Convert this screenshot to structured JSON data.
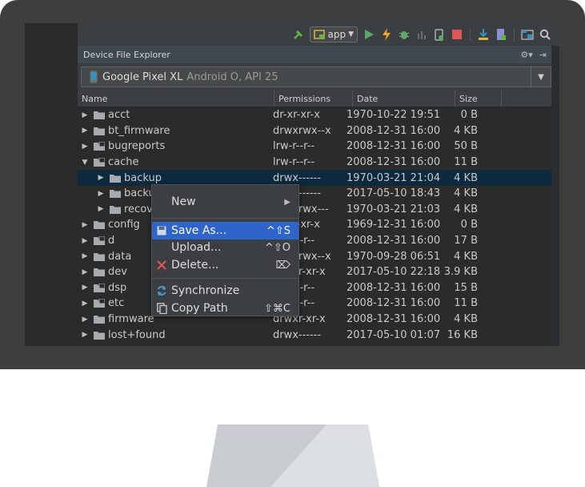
{
  "toolbar": {
    "run_config": "app",
    "icons": [
      "hammer-icon",
      "run-config-icon",
      "run-icon",
      "apply-changes-icon",
      "debug-icon",
      "profile-icon",
      "attach-debugger-icon",
      "stop-icon",
      "sdk-manager-icon",
      "avd-manager-icon",
      "project-structure-icon",
      "search-icon"
    ]
  },
  "panel": {
    "title": "Device File Explorer",
    "gear": "⚙▾",
    "hide": "⇥"
  },
  "device": {
    "name": "Google Pixel XL",
    "version": "Android O, API 25"
  },
  "table": {
    "columns": [
      "Name",
      "Permissions",
      "Date",
      "Size"
    ],
    "rows": [
      {
        "name": "acct",
        "indent": 0,
        "expanded": false,
        "type": "folder",
        "perm": "dr-xr-xr-x",
        "date": "1970-10-22 19:51",
        "size": "0 B"
      },
      {
        "name": "bt_firmware",
        "indent": 0,
        "expanded": false,
        "type": "folder",
        "perm": "drwxrwx--x",
        "date": "2008-12-31 16:00",
        "size": "4 KB"
      },
      {
        "name": "bugreports",
        "indent": 0,
        "expanded": false,
        "type": "link",
        "perm": "lrw-r--r--",
        "date": "2008-12-31 16:00",
        "size": "50 B"
      },
      {
        "name": "cache",
        "indent": 0,
        "expanded": true,
        "type": "link",
        "perm": "lrw-r--r--",
        "date": "2008-12-31 16:00",
        "size": "11 B"
      },
      {
        "name": "backup",
        "indent": 1,
        "expanded": false,
        "type": "folder",
        "perm": "drwx------",
        "date": "1970-03-21 21:04",
        "size": "4 KB",
        "selected": true
      },
      {
        "name": "backup_stage",
        "indent": 1,
        "expanded": false,
        "type": "folder",
        "perm": "drwx------",
        "date": "2017-05-10 18:43",
        "size": "4 KB"
      },
      {
        "name": "recovery",
        "indent": 1,
        "expanded": false,
        "type": "folder",
        "perm": "drwxrwx---",
        "date": "1970-03-21 21:03",
        "size": "4 KB"
      },
      {
        "name": "config",
        "indent": 0,
        "expanded": false,
        "type": "folder",
        "perm": "dr-xr-xr-x",
        "date": "1969-12-31 16:00",
        "size": "0 B"
      },
      {
        "name": "d",
        "indent": 0,
        "expanded": false,
        "type": "link",
        "perm": "lrw-r--r--",
        "date": "2008-12-31 16:00",
        "size": "17 B"
      },
      {
        "name": "data",
        "indent": 0,
        "expanded": false,
        "type": "folder",
        "perm": "drwxrwx--x",
        "date": "1970-09-28 06:51",
        "size": "4 KB"
      },
      {
        "name": "dev",
        "indent": 0,
        "expanded": false,
        "type": "folder",
        "perm": "drwxr-xr-x",
        "date": "2017-05-10 22:18",
        "size": "3.9 KB"
      },
      {
        "name": "dsp",
        "indent": 0,
        "expanded": false,
        "type": "link",
        "perm": "lrw-r--r--",
        "date": "2008-12-31 16:00",
        "size": "15 B"
      },
      {
        "name": "etc",
        "indent": 0,
        "expanded": false,
        "type": "link",
        "perm": "lrw-r--r--",
        "date": "2008-12-31 16:00",
        "size": "11 B"
      },
      {
        "name": "firmware",
        "indent": 0,
        "expanded": false,
        "type": "folder",
        "perm": "drwxr-xr-x",
        "date": "2008-12-31 16:00",
        "size": "4 KB"
      },
      {
        "name": "lost+found",
        "indent": 0,
        "expanded": false,
        "type": "folder",
        "perm": "drwx------",
        "date": "2017-05-10 01:07",
        "size": "16 KB"
      }
    ]
  },
  "context_menu": {
    "new": {
      "label": "New",
      "arrow": "▶"
    },
    "save_as": {
      "label": "Save As...",
      "shortcut": "^⇧S"
    },
    "upload": {
      "label": "Upload...",
      "shortcut": "^⇧O"
    },
    "delete": {
      "label": "Delete...",
      "shortcut": "⌦"
    },
    "synchronize": {
      "label": "Synchronize"
    },
    "copy_path": {
      "label": "Copy Path",
      "shortcut": "⇧⌘C"
    }
  },
  "colors": {
    "selection": "#0d293e",
    "menu_highlight": "#2f65ca",
    "bezel": "#3e3e3f"
  }
}
